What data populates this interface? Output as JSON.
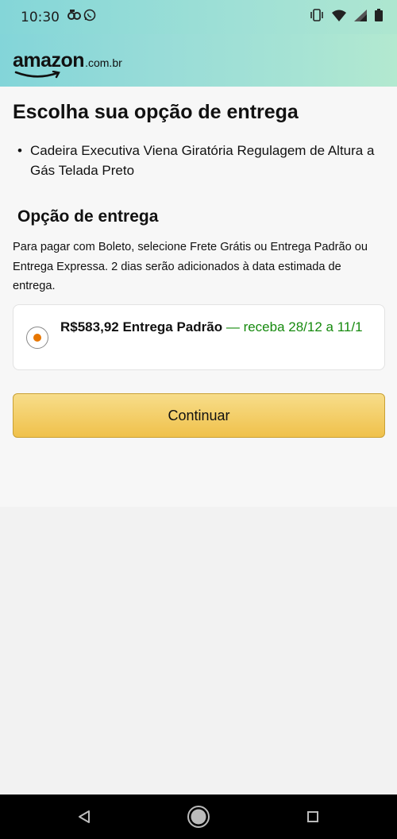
{
  "status_bar": {
    "time": "10:30",
    "notification_icons": [
      "data-saver-icon",
      "whatsapp-icon"
    ],
    "right_icons": [
      "vibrate-icon",
      "wifi-icon",
      "signal-icon",
      "battery-icon"
    ]
  },
  "header": {
    "logo_text": "amazon",
    "logo_suffix": ".com.br"
  },
  "main": {
    "title": "Escolha sua opção de entrega",
    "items": [
      "Cadeira Executiva Viena Giratória Regulagem de Altura a Gás Telada Preto"
    ],
    "delivery_section_title": "Opção de entrega",
    "info_text": "Para pagar com Boleto, selecione Frete Grátis ou Entrega Padrão ou Entrega Expressa. 2 dias serão adicionados à data estimada de entrega.",
    "options": [
      {
        "price_label": "R$583,92 Entrega Padrão",
        "date_label": "— receba 28/12 a 11/1",
        "selected": true
      }
    ],
    "continue_label": "Continuar"
  },
  "nav_bar": {
    "buttons": [
      "back-icon",
      "home-icon",
      "recents-icon"
    ]
  },
  "colors": {
    "accent_orange": "#e77600",
    "date_green": "#168a0e",
    "button_yellow": "#f0c14b",
    "header_teal": "#84d6d8"
  }
}
